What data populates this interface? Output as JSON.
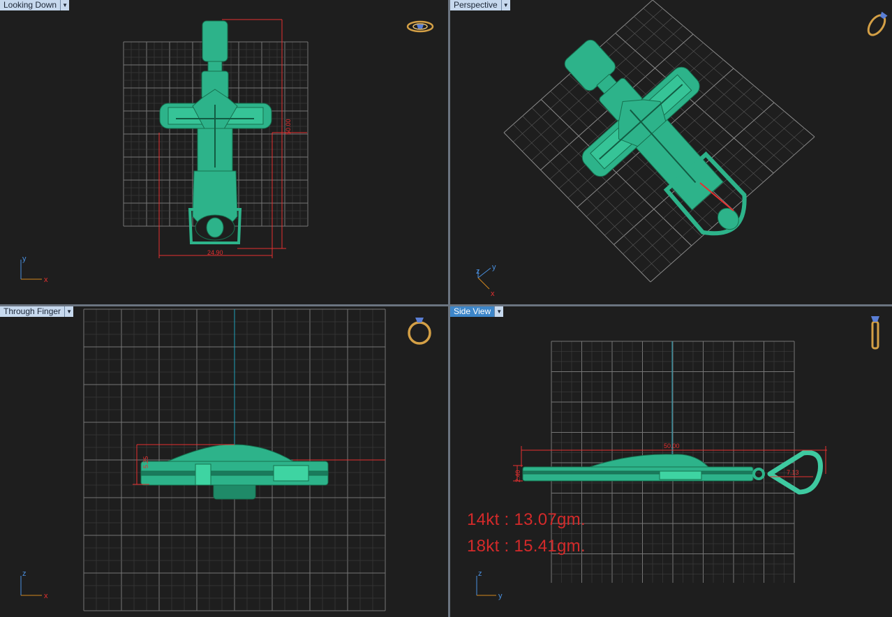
{
  "viewports": {
    "looking_down": {
      "label": "Looking Down",
      "dims": {
        "width": "24.90",
        "height": "50.00"
      },
      "axes": {
        "v": "y",
        "h": "x"
      }
    },
    "perspective": {
      "label": "Perspective",
      "axes": {
        "a": "z",
        "b": "y",
        "c": "x"
      }
    },
    "through_finger": {
      "label": "Through Finger",
      "dims": {
        "thickness": "5.25"
      },
      "axes": {
        "v": "z",
        "h": "x"
      }
    },
    "side_view": {
      "label": "Side View",
      "dims": {
        "length": "50.00",
        "depth": "2.40",
        "bail": "7.13"
      },
      "axes": {
        "v": "z",
        "h": "y"
      }
    }
  },
  "weights": {
    "kt14": "14kt : 13.07gm.",
    "kt18": "18kt : 15.41gm."
  },
  "icons": {
    "looking_down": "ring-top-icon",
    "perspective": "ring-perspective-icon",
    "through_finger": "ring-front-icon",
    "side_view": "ring-side-icon"
  },
  "colors": {
    "model": "#2db38a",
    "model_dark": "#1a7a5c",
    "dimension": "#e53030",
    "grid": "#6a6a6a",
    "axis_line": "#1ea0b8",
    "active_tab": "#3d86c9"
  }
}
